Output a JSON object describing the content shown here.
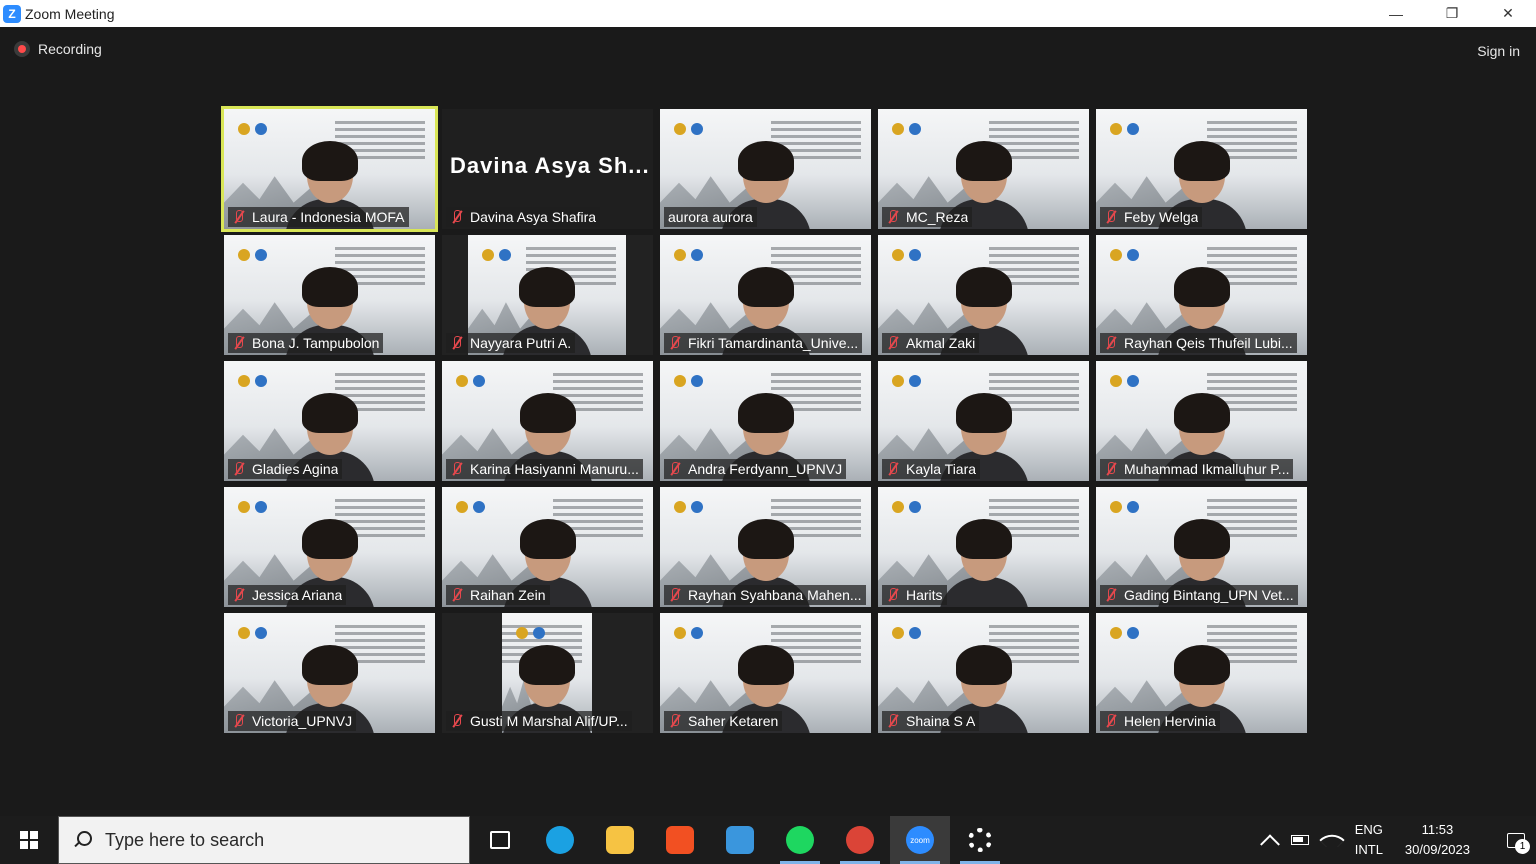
{
  "window": {
    "title": "Zoom Meeting",
    "minimize_icon": "—",
    "restore_icon": "❐",
    "close_icon": "✕",
    "logo_letter": "Z"
  },
  "meeting": {
    "recording_label": "Recording",
    "sign_in_label": "Sign in",
    "active_speaker_color": "#d9e657",
    "muted_color": "#e5484d"
  },
  "participants": [
    {
      "name": "Laura - Indonesia MOFA",
      "muted": true,
      "active": true,
      "video": true
    },
    {
      "name": "Davina Asya Shafira",
      "muted": true,
      "video": false,
      "display_name": "Davina Asya Sh..."
    },
    {
      "name": "aurora aurora",
      "muted": false,
      "video": true
    },
    {
      "name": "MC_Reza",
      "muted": true,
      "video": true
    },
    {
      "name": "Feby Welga",
      "muted": true,
      "video": true
    },
    {
      "name": "Bona J. Tampubolon",
      "muted": true,
      "video": true
    },
    {
      "name": "Nayyara Putri A.",
      "muted": true,
      "video": true,
      "inset": true
    },
    {
      "name": "Fikri Tamardinanta_Unive...",
      "muted": true,
      "video": true
    },
    {
      "name": "Akmal Zaki",
      "muted": true,
      "video": true
    },
    {
      "name": "Rayhan Qeis Thufeil Lubi...",
      "muted": true,
      "video": true
    },
    {
      "name": "Gladies Agina",
      "muted": true,
      "video": true
    },
    {
      "name": "Karina Hasiyanni Manuru...",
      "muted": true,
      "video": true
    },
    {
      "name": "Andra Ferdyann_UPNVJ",
      "muted": true,
      "video": true
    },
    {
      "name": "Kayla Tiara",
      "muted": true,
      "video": true
    },
    {
      "name": "Muhammad Ikmalluhur P...",
      "muted": true,
      "video": true
    },
    {
      "name": "Jessica Ariana",
      "muted": true,
      "video": true
    },
    {
      "name": "Raihan Zein",
      "muted": true,
      "video": true
    },
    {
      "name": "Rayhan Syahbana Mahen...",
      "muted": true,
      "video": true
    },
    {
      "name": "Harits",
      "muted": true,
      "video": true
    },
    {
      "name": "Gading Bintang_UPN Vet...",
      "muted": true,
      "video": true
    },
    {
      "name": "Victoria_UPNVJ",
      "muted": true,
      "video": true
    },
    {
      "name": "Gusti M Marshal Alif/UP...",
      "muted": true,
      "video": true,
      "inset": true
    },
    {
      "name": "Saher Ketaren",
      "muted": true,
      "video": true
    },
    {
      "name": "Shaina S A",
      "muted": true,
      "video": true
    },
    {
      "name": "Helen Hervinia",
      "muted": true,
      "video": true
    }
  ],
  "taskbar": {
    "search_placeholder": "Type here to search",
    "apps": [
      {
        "id": "task-view",
        "icon": "task-view-icon",
        "color": "#ffffff",
        "running": false
      },
      {
        "id": "edge",
        "icon": "edge-icon",
        "color": "#1ba1e2",
        "running": false
      },
      {
        "id": "file-explorer",
        "icon": "folder-icon",
        "color": "#f6c343",
        "running": false
      },
      {
        "id": "store",
        "icon": "store-icon",
        "color": "#f25022",
        "running": false
      },
      {
        "id": "mail",
        "icon": "mail-icon",
        "color": "#3a96dd",
        "running": false
      },
      {
        "id": "spotify",
        "icon": "spotify-icon",
        "color": "#1ed760",
        "running": true
      },
      {
        "id": "chrome",
        "icon": "chrome-icon",
        "color": "#db4437",
        "running": true
      },
      {
        "id": "zoom",
        "icon": "zoom-icon",
        "color": "#2d8cff",
        "running": true,
        "active": true,
        "label": "zoom"
      },
      {
        "id": "settings",
        "icon": "gear-icon",
        "color": "#ffffff",
        "running": true
      }
    ],
    "tray": {
      "lang_top": "ENG",
      "lang_bottom": "INTL",
      "time": "11:53",
      "date": "30/09/2023",
      "notifications": "1"
    }
  }
}
